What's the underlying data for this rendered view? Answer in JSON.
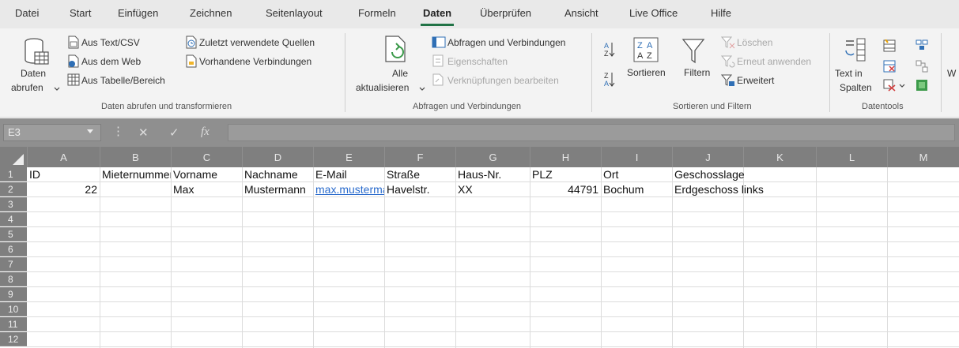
{
  "menu": {
    "tabs": [
      {
        "label": "Datei"
      },
      {
        "label": "Start"
      },
      {
        "label": "Einfügen"
      },
      {
        "label": "Zeichnen"
      },
      {
        "label": "Seitenlayout"
      },
      {
        "label": "Formeln"
      },
      {
        "label": "Daten"
      },
      {
        "label": "Überprüfen"
      },
      {
        "label": "Ansicht"
      },
      {
        "label": "Live Office"
      },
      {
        "label": "Hilfe"
      }
    ],
    "active": "Daten"
  },
  "ribbon": {
    "get_data": {
      "daten_line1": "Daten",
      "daten_line2": "abrufen",
      "aus_text_csv": "Aus Text/CSV",
      "aus_dem_web": "Aus dem Web",
      "aus_tabelle": "Aus Tabelle/Bereich",
      "zuletzt": "Zuletzt verwendete Quellen",
      "vorhandene": "Vorhandene Verbindungen",
      "group_label": "Daten abrufen und transformieren"
    },
    "queries": {
      "alle_line1": "Alle",
      "alle_line2": "aktualisieren",
      "abfragen": "Abfragen und Verbindungen",
      "eigenschaften": "Eigenschaften",
      "verknuepfungen": "Verknüpfungen bearbeiten",
      "group_label": "Abfragen und Verbindungen"
    },
    "sort": {
      "sortieren": "Sortieren",
      "filtern": "Filtern",
      "loeschen": "Löschen",
      "erneut": "Erneut anwenden",
      "erweitert": "Erweitert",
      "group_label": "Sortieren und Filtern"
    },
    "tools": {
      "text_line1": "Text in",
      "text_line2": "Spalten",
      "group_label": "Datentools",
      "overflow": "W"
    },
    "colors": {
      "ribbon_bg": "#f3f3f3",
      "accent_green": "#217346",
      "icon_blue": "#2f6fb5"
    }
  },
  "formula_bar": {
    "name_box": "E3",
    "cancel_glyph": "✕",
    "enter_glyph": "✓",
    "fx_glyph": "fx",
    "formula": ""
  },
  "sheet": {
    "columns": [
      "A",
      "B",
      "C",
      "D",
      "E",
      "F",
      "G",
      "H",
      "I",
      "J",
      "K",
      "L",
      "M"
    ],
    "rows": [
      "1",
      "2",
      "3",
      "4",
      "5",
      "6",
      "7",
      "8",
      "9",
      "10",
      "11",
      "12"
    ],
    "header_row": {
      "A": "ID",
      "B": "Mieternummer",
      "C": "Vorname",
      "D": "Nachname",
      "E": "E-Mail",
      "F": "Straße",
      "G": "Haus-Nr.",
      "H": "PLZ",
      "I": "Ort",
      "J": "Geschosslage"
    },
    "data_row": {
      "A": "22",
      "C": "Max",
      "D": "Mustermann",
      "E": "max.mustermann",
      "F": "Havelstr.",
      "G": "XX",
      "H": "44791",
      "I": "Bochum",
      "J": "Erdgeschoss links"
    },
    "selected_cell": "E3"
  }
}
